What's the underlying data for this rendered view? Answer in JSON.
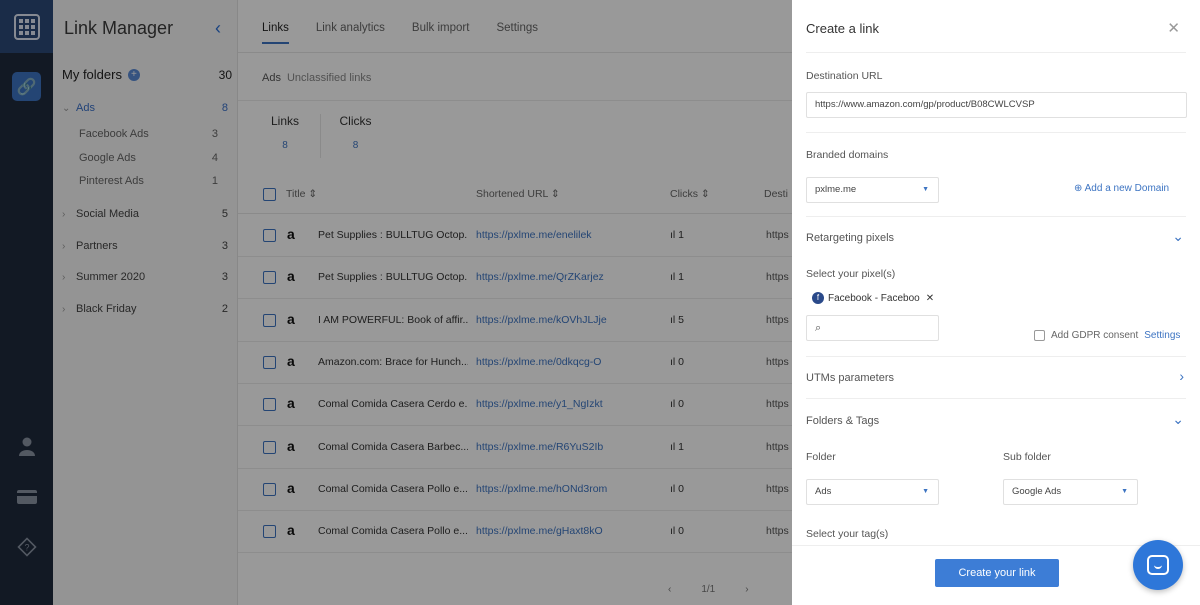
{
  "app": {
    "title": "Link Manager"
  },
  "folders": {
    "heading": "My folders",
    "total": "30",
    "items": [
      {
        "label": "Ads",
        "count": "8",
        "active": true
      },
      {
        "label": "Facebook Ads",
        "count": "3",
        "sub": true
      },
      {
        "label": "Google Ads",
        "count": "4",
        "sub": true
      },
      {
        "label": "Pinterest Ads",
        "count": "1",
        "sub": true
      },
      {
        "label": "Social Media",
        "count": "5"
      },
      {
        "label": "Partners",
        "count": "3"
      },
      {
        "label": "Summer 2020",
        "count": "3"
      },
      {
        "label": "Black Friday",
        "count": "2"
      }
    ]
  },
  "tabs": [
    "Links",
    "Link analytics",
    "Bulk import",
    "Settings"
  ],
  "breadcrumb": {
    "folder": "Ads",
    "filter": "Unclassified links"
  },
  "stats": {
    "links_label": "Links",
    "links_value": "8",
    "clicks_label": "Clicks",
    "clicks_value": "8"
  },
  "table": {
    "columns": [
      "Title",
      "Shortened URL",
      "Clicks",
      "Desti"
    ],
    "rows": [
      {
        "title": "Pet Supplies : BULLTUG Octop...",
        "url": "https://pxlme.me/enelilek",
        "clicks": "1",
        "dest": "https"
      },
      {
        "title": "Pet Supplies : BULLTUG Octop...",
        "url": "https://pxlme.me/QrZKarjez",
        "clicks": "1",
        "dest": "https"
      },
      {
        "title": "I AM POWERFUL: Book of affir...",
        "url": "https://pxlme.me/kOVhJLJje",
        "clicks": "5",
        "dest": "https"
      },
      {
        "title": "Amazon.com: Brace for Hunch...",
        "url": "https://pxlme.me/0dkqcg-O",
        "clicks": "0",
        "dest": "https"
      },
      {
        "title": "Comal Comida Casera Cerdo e...",
        "url": "https://pxlme.me/y1_NgIzkt",
        "clicks": "0",
        "dest": "https"
      },
      {
        "title": "Comal Comida Casera Barbec...",
        "url": "https://pxlme.me/R6YuS2Ib",
        "clicks": "1",
        "dest": "https"
      },
      {
        "title": "Comal Comida Casera Pollo e...",
        "url": "https://pxlme.me/hONd3rom",
        "clicks": "0",
        "dest": "https"
      },
      {
        "title": "Comal Comida Casera Pollo e...",
        "url": "https://pxlme.me/gHaxt8kO",
        "clicks": "0",
        "dest": "https"
      }
    ]
  },
  "pager": {
    "page": "1/1"
  },
  "drawer": {
    "title": "Create a link",
    "dest_label": "Destination URL",
    "dest_value": "https://www.amazon.com/gp/product/B08CWLCVSP",
    "branded_label": "Branded domains",
    "branded_value": "pxlme.me",
    "add_domain": "Add a new Domain",
    "retargeting_label": "Retargeting pixels",
    "select_pixels": "Select your pixel(s)",
    "pixel_chip": "Facebook - Faceboo",
    "gdpr_label": "Add GDPR consent",
    "settings_link": "Settings",
    "utm_label": "UTMs parameters",
    "folders_tags_label": "Folders & Tags",
    "folder_label": "Folder",
    "folder_value": "Ads",
    "subfolder_label": "Sub folder",
    "subfolder_value": "Google Ads",
    "tags_label": "Select your tag(s)",
    "cta": "Create your link"
  }
}
